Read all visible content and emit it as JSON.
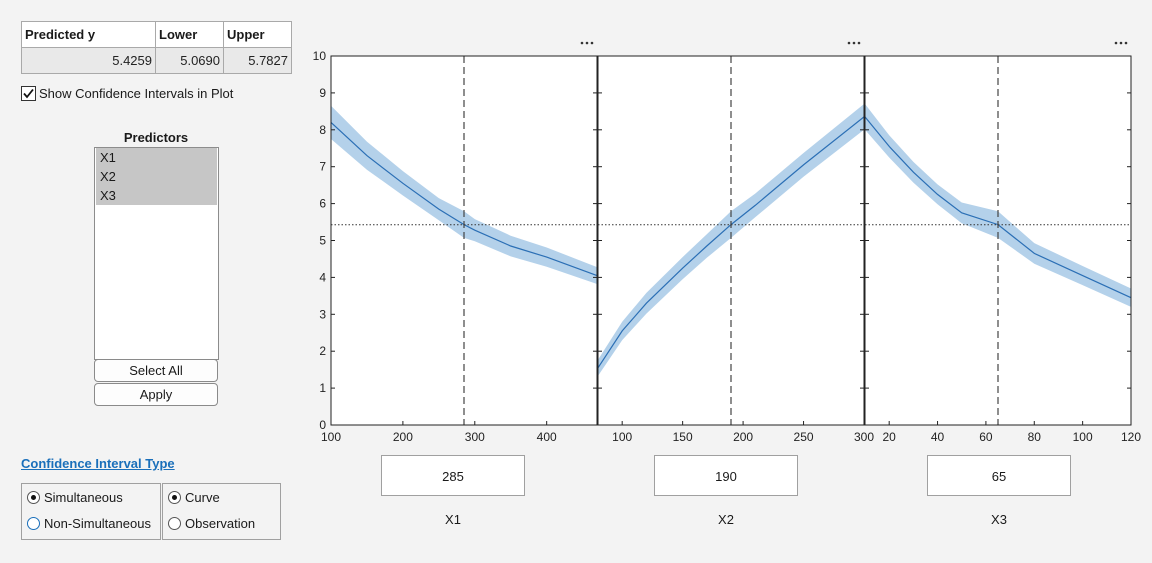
{
  "table": {
    "headers": [
      "Predicted y",
      "Lower",
      "Upper"
    ],
    "values": [
      "5.4259",
      "5.0690",
      "5.7827"
    ]
  },
  "show_ci": {
    "label": "Show Confidence Intervals in Plot",
    "checked": true
  },
  "predictors": {
    "title": "Predictors",
    "items": [
      "X1",
      "X2",
      "X3"
    ],
    "select_all_label": "Select All",
    "apply_label": "Apply"
  },
  "ci_type": {
    "title": "Confidence Interval Type",
    "group1": [
      {
        "label": "Simultaneous",
        "selected": true
      },
      {
        "label": "Non-Simultaneous",
        "selected": false
      }
    ],
    "group2": [
      {
        "label": "Curve",
        "selected": true
      },
      {
        "label": "Observation",
        "selected": false
      }
    ]
  },
  "panels": [
    {
      "name": "X1",
      "value": "285",
      "more_icon": "ellipsis-icon"
    },
    {
      "name": "X2",
      "value": "190",
      "more_icon": "ellipsis-icon"
    },
    {
      "name": "X3",
      "value": "65",
      "more_icon": "ellipsis-icon"
    }
  ],
  "colors": {
    "line": "#2b6fb5",
    "band": "#b4d1ea",
    "accent": "#1a6fba"
  },
  "chart_data": {
    "type": "line",
    "ylim": [
      0,
      10
    ],
    "yticks": [
      "0",
      "1",
      "2",
      "3",
      "4",
      "5",
      "6",
      "7",
      "8",
      "9",
      "10"
    ],
    "reference_y": 5.4259,
    "subplots": [
      {
        "xlabel": "X1",
        "xlim": [
          100,
          470
        ],
        "xticks": [
          100,
          200,
          300,
          400
        ],
        "xtick_labels": [
          "100",
          "200",
          "300",
          "400"
        ],
        "current_x": 285,
        "x": [
          100,
          150,
          200,
          250,
          285,
          300,
          350,
          400,
          470
        ],
        "y": [
          8.2,
          7.3,
          6.55,
          5.85,
          5.43,
          5.28,
          4.85,
          4.55,
          4.05
        ],
        "half_width": [
          0.45,
          0.38,
          0.33,
          0.3,
          0.36,
          0.3,
          0.28,
          0.26,
          0.23
        ]
      },
      {
        "xlabel": "X2",
        "xlim": [
          80,
          300
        ],
        "xticks": [
          100,
          150,
          200,
          250,
          300
        ],
        "xtick_labels": [
          "100",
          "150",
          "200",
          "250",
          "300"
        ],
        "current_x": 190,
        "x": [
          80,
          100,
          120,
          150,
          170,
          190,
          210,
          250,
          300
        ],
        "y": [
          1.55,
          2.55,
          3.3,
          4.25,
          4.85,
          5.43,
          5.95,
          7.05,
          8.35
        ],
        "half_width": [
          0.22,
          0.25,
          0.28,
          0.3,
          0.32,
          0.36,
          0.32,
          0.32,
          0.35
        ]
      },
      {
        "xlabel": "X3",
        "xlim": [
          10,
          120
        ],
        "xticks": [
          20,
          40,
          60,
          80,
          100,
          120
        ],
        "xtick_labels": [
          "20",
          "40",
          "60",
          "80",
          "100",
          "120"
        ],
        "current_x": 65,
        "x": [
          10,
          20,
          30,
          40,
          50,
          65,
          80,
          100,
          120
        ],
        "y": [
          8.35,
          7.55,
          6.85,
          6.25,
          5.75,
          5.43,
          4.65,
          4.05,
          3.45
        ],
        "half_width": [
          0.35,
          0.3,
          0.28,
          0.27,
          0.28,
          0.36,
          0.28,
          0.26,
          0.25
        ]
      }
    ]
  }
}
